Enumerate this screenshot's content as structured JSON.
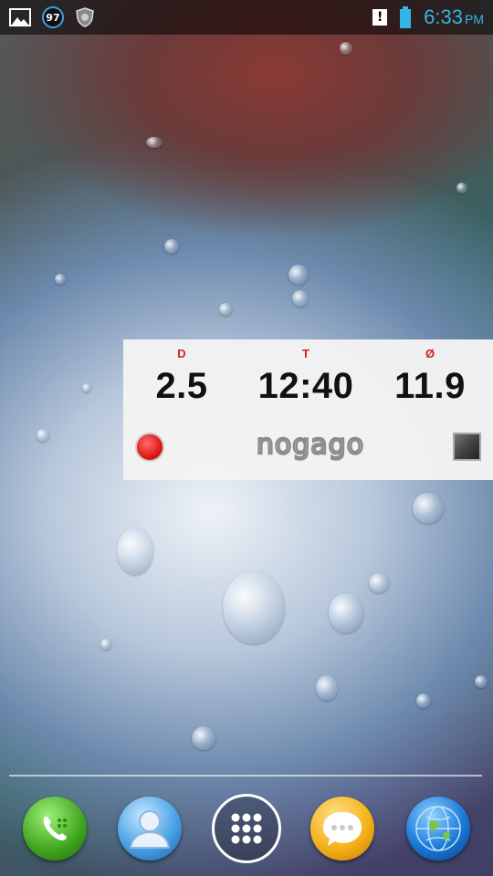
{
  "status_bar": {
    "notification_count": "97",
    "time": "6:33",
    "ampm": "PM",
    "icons": [
      "gallery-icon",
      "notification-count-icon",
      "shield-icon",
      "alert-icon",
      "battery-icon"
    ],
    "accent_color": "#33b5e5"
  },
  "widget": {
    "columns": [
      {
        "label": "D",
        "value": "2.5"
      },
      {
        "label": "T",
        "value": "12:40"
      },
      {
        "label": "Ø",
        "value": "11.9"
      }
    ],
    "logo_text": "nogago",
    "label_color": "#d32020",
    "record_color": "#e01818"
  },
  "dock": {
    "icons": [
      "phone-icon",
      "contacts-icon",
      "apps-grid-icon",
      "messaging-icon",
      "browser-icon"
    ]
  }
}
